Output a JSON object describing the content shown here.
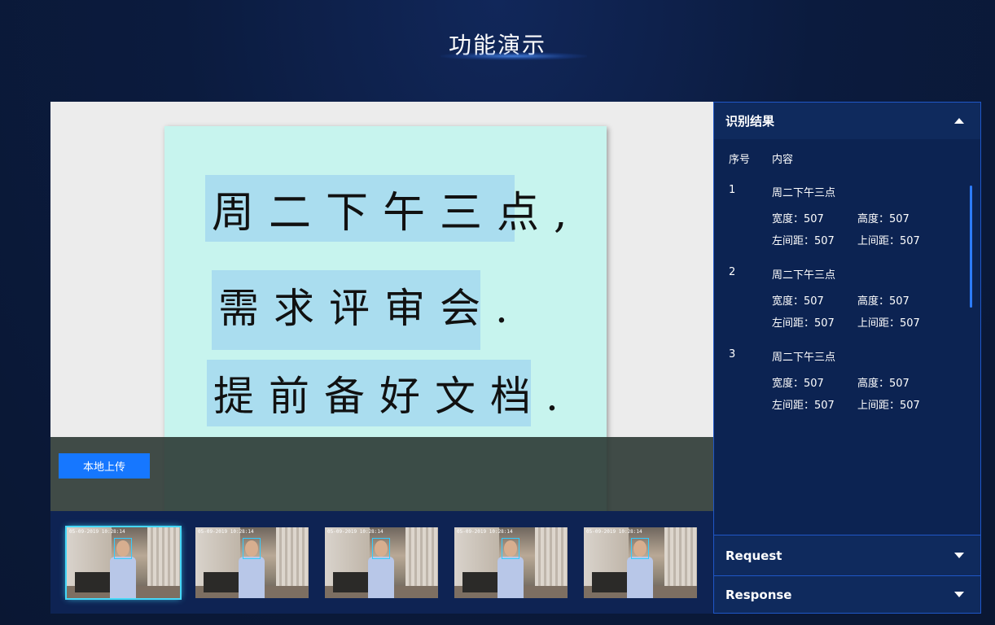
{
  "page": {
    "title": "功能演示"
  },
  "upload_button": {
    "label": "本地上传"
  },
  "note": {
    "lines": [
      "周二下午三点,",
      "需求评审会.",
      "提前备好文档."
    ]
  },
  "thumbnails": [
    {
      "timestamp": "05-09-2019 10:28:14",
      "active": true
    },
    {
      "timestamp": "05-09-2019 10:28:14",
      "active": false
    },
    {
      "timestamp": "05-09-2019 10:28:14",
      "active": false
    },
    {
      "timestamp": "05-09-2019 10:28:14",
      "active": false
    },
    {
      "timestamp": "05-09-2019 10:28:14",
      "active": false
    }
  ],
  "results_panel": {
    "title": "识别结果",
    "columns": {
      "index": "序号",
      "content": "内容"
    },
    "items": [
      {
        "index": "1",
        "text": "周二下午三点",
        "width": "宽度：507",
        "height": "高度：507",
        "left": "左间距：507",
        "top": "上间距：507"
      },
      {
        "index": "2",
        "text": "周二下午三点",
        "width": "宽度：507",
        "height": "高度：507",
        "left": "左间距：507",
        "top": "上间距：507"
      },
      {
        "index": "3",
        "text": "周二下午三点",
        "width": "宽度：507",
        "height": "高度：507",
        "left": "左间距：507",
        "top": "上间距：507"
      }
    ]
  },
  "request_panel": {
    "title": "Request"
  },
  "response_panel": {
    "title": "Response"
  },
  "colors": {
    "accent": "#1677ff",
    "panel_border": "#1f57c7",
    "background": "#0b1a3a",
    "thumb_active": "#45d8f8"
  }
}
